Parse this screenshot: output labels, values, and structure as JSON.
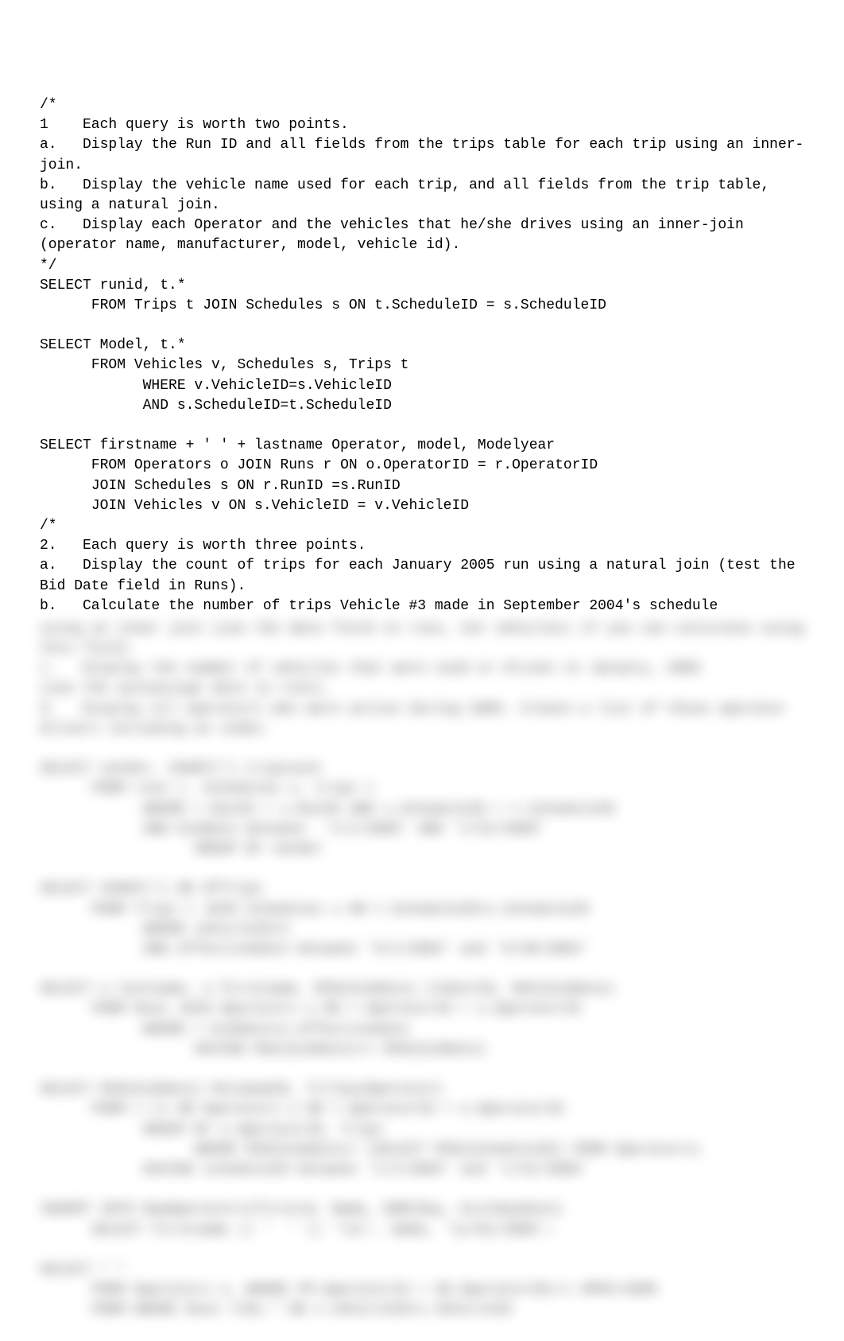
{
  "visible_text": "/*\n1    Each query is worth two points.\na.   Display the Run ID and all fields from the trips table for each trip using an inner-join.\nb.   Display the vehicle name used for each trip, and all fields from the trip table, using a natural join.\nc.   Display each Operator and the vehicles that he/she drives using an inner-join (operator name, manufacturer, model, vehicle id).\n*/\nSELECT runid, t.*\n      FROM Trips t JOIN Schedules s ON t.ScheduleID = s.ScheduleID\n\nSELECT Model, t.*\n      FROM Vehicles v, Schedules s, Trips t\n            WHERE v.VehicleID=s.VehicleID\n            AND s.ScheduleID=t.ScheduleID\n\nSELECT firstname + ' ' + lastname Operator, model, Modelyear\n      FROM Operators o JOIN Runs r ON o.OperatorID = r.OperatorID\n      JOIN Schedules s ON r.RunID =s.RunID\n      JOIN Vehicles v ON s.VehicleID = v.VehicleID\n/*\n2.   Each query is worth three points.\na.   Display the count of trips for each January 2005 run using a natural join (test the Bid Date field in Runs).\nb.   Calculate the number of trips Vehicle #3 made in September 2004's schedule",
  "blurred_text": "using an inner join (use the date field in runs, not vehicles) if you can calculate using this field.\nc.   Display the number of vehicles that were used or driven in January, 2005\n(use the autoassign date in runs).\nd.   Display all operators who were active during 2005. Create a list of those operator drivers including an index.\n\nSELECT vendor, COUNT(*) tripcount\n      FROM runs r, Schedules s, trips t\n            WHERE r.RunID = s.RunID AND s.ScheduleID = t.ScheduleID\n            AND biddate between  '1/1/2005' AND '1/31/2005'\n                  GROUP BY vendor\n\nSELECT COUNT(*) NO OfTrips\n      FROM Trips t JOIN Schedules s ON t.ScheduleID=s.ScheduleID\n            WHERE vehicleID=3\n            AND effectiveDate between '9/1/2004' and '9/30/2004'\n\nSELECT o.lastname, o.firstname, MIN(biddate) oldestID, MAX(biddate)\n      FROM Runs JOIN Operators o ON r.OperatorID = o.OperatorID\n            WHERE r.biddate=o.effectivedate\n                  HAVING MAX(biddate)<= MIN(biddate)\n\nSELECT MIN(biddate) MinimumID, T(T)SysOperator1\n      FROM r.r1 ON Operators o ON r.OperatorID = o.OperatorID\n            GROUP BY o.OperatorID, Trips\n                  WHERE MIN(biddate)< (SELECT MIN(ScheduleID) FROM Operators)\n            HAVING scheduleID between '1/1/2004' and '1/31/2005'\n\nINSERT INTO NewOperators(firstid, Name, DOB(Day, ExitDayDate)\n      SELECT firstname || '  ' || 'lst', Name, '11/01/2005';\n\nSELECT * *\n      FROM Operators o, WHERE FM.OperatorId = SD.OperatorID(+) OPRI=2005\n      FROM WHERE Runs rIds.* ON v.VehicleID=s.VehicleID"
}
